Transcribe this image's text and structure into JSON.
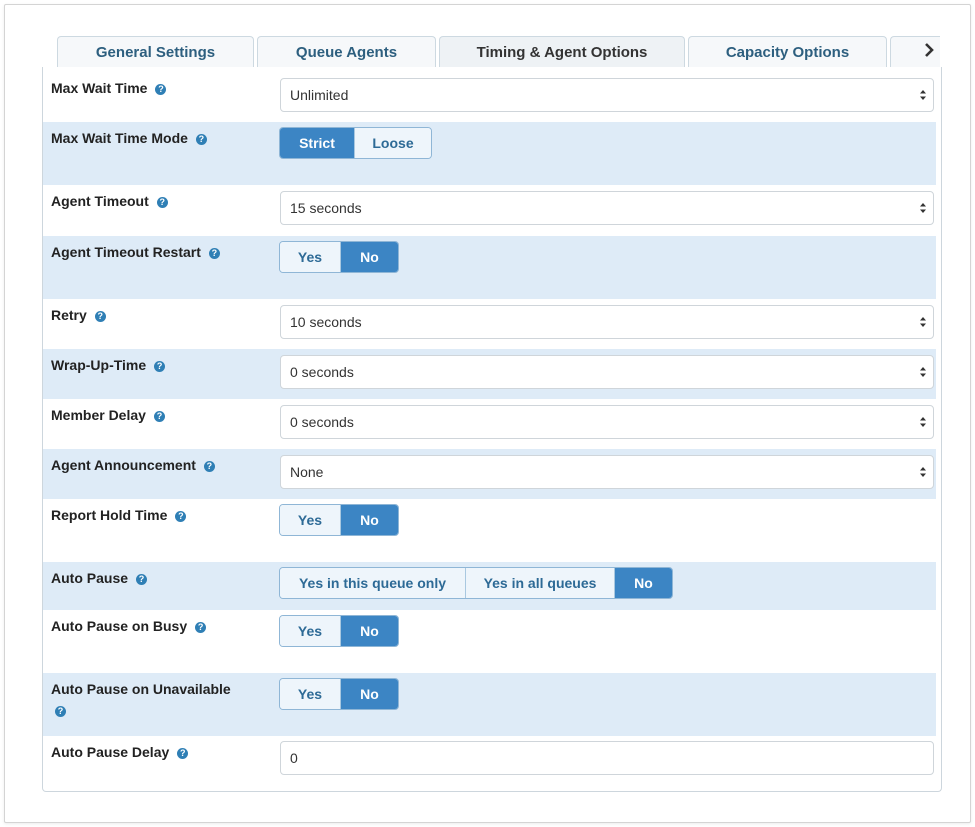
{
  "tabs": [
    {
      "label": "General Settings",
      "active": false
    },
    {
      "label": "Queue Agents",
      "active": false
    },
    {
      "label": "Timing & Agent Options",
      "active": true
    },
    {
      "label": "Capacity Options",
      "active": false
    }
  ],
  "help_glyph": "?",
  "fields": {
    "max_wait_time": {
      "label": "Max Wait Time",
      "value": "Unlimited"
    },
    "max_wait_time_mode": {
      "label": "Max Wait Time Mode",
      "options": [
        "Strict",
        "Loose"
      ],
      "selected": "Strict"
    },
    "agent_timeout": {
      "label": "Agent Timeout",
      "value": "15 seconds"
    },
    "agent_timeout_restart": {
      "label": "Agent Timeout Restart",
      "options": [
        "Yes",
        "No"
      ],
      "selected": "No"
    },
    "retry": {
      "label": "Retry",
      "value": "10 seconds"
    },
    "wrap_up_time": {
      "label": "Wrap-Up-Time",
      "value": "0 seconds"
    },
    "member_delay": {
      "label": "Member Delay",
      "value": "0 seconds"
    },
    "agent_announcement": {
      "label": "Agent Announcement",
      "value": "None"
    },
    "report_hold_time": {
      "label": "Report Hold Time",
      "options": [
        "Yes",
        "No"
      ],
      "selected": "No"
    },
    "auto_pause": {
      "label": "Auto Pause",
      "options": [
        "Yes in this queue only",
        "Yes in all queues",
        "No"
      ],
      "selected": "No"
    },
    "auto_pause_busy": {
      "label": "Auto Pause on Busy",
      "options": [
        "Yes",
        "No"
      ],
      "selected": "No"
    },
    "auto_pause_unavailable": {
      "label": "Auto Pause on Unavailable",
      "options": [
        "Yes",
        "No"
      ],
      "selected": "No"
    },
    "auto_pause_delay": {
      "label": "Auto Pause Delay",
      "value": "0"
    }
  },
  "colors": {
    "accent": "#3c85c4",
    "row_shade": "#deebf7",
    "help_icon": "#2f7fb5"
  }
}
